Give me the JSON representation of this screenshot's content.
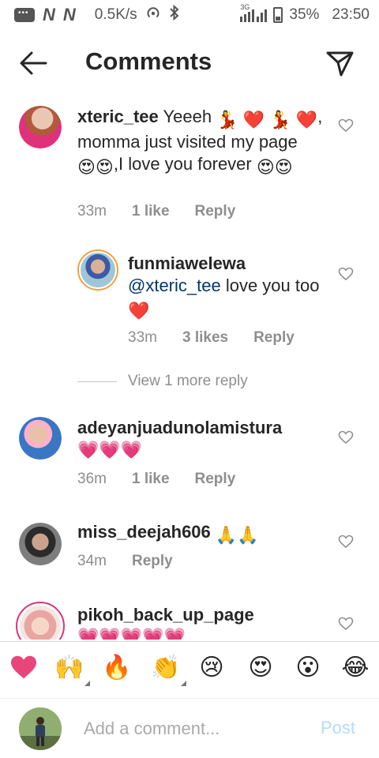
{
  "status_bar": {
    "network_speed": "0.5K/s",
    "network_type": "3G",
    "battery": "35%",
    "time": "23:50",
    "icons": [
      "message-icon",
      "n-icon",
      "n-icon",
      "hotspot-icon",
      "bluetooth-icon",
      "signal-icon",
      "battery-icon"
    ]
  },
  "header": {
    "title": "Comments",
    "back_icon": "back-arrow-icon",
    "send_icon": "paper-plane-icon"
  },
  "comments": [
    {
      "username": "xteric_tee",
      "text_parts": [
        "Yeeeh ",
        "💃",
        " ",
        "❤️",
        " ",
        "💃",
        " ",
        "❤️",
        ", momma just visited my page",
        "😍😍",
        ",I love you forever ",
        "😍😍"
      ],
      "time": "33m",
      "likes": "1 like",
      "reply": "Reply"
    },
    {
      "username": "funmiawelewa",
      "mention": "@xteric_tee",
      "text": " love you too ",
      "emoji": "❤️",
      "time": "33m",
      "likes": "3 likes",
      "reply": "Reply"
    },
    {
      "username": "adeyanjuadunolamistura",
      "emoji": "💗💗💗",
      "time": "36m",
      "likes": "1 like",
      "reply": "Reply"
    },
    {
      "username": "miss_deejah606",
      "emoji": "🙏🙏",
      "time": "34m",
      "reply": "Reply"
    },
    {
      "username": "pikoh_back_up_page",
      "emoji": "💗💗💗💗💗"
    }
  ],
  "view_more": "View 1 more reply",
  "reactions": [
    "❤️",
    "🙌",
    "🔥",
    "👏",
    "😢",
    "😍",
    "😮",
    "😂"
  ],
  "composer": {
    "placeholder": "Add a comment...",
    "post_label": "Post"
  },
  "colors": {
    "text": "#262626",
    "muted": "#8e8e8e",
    "mention": "#00376b",
    "post_disabled": "#b3dbff",
    "heart_pink": "#e8457a"
  }
}
